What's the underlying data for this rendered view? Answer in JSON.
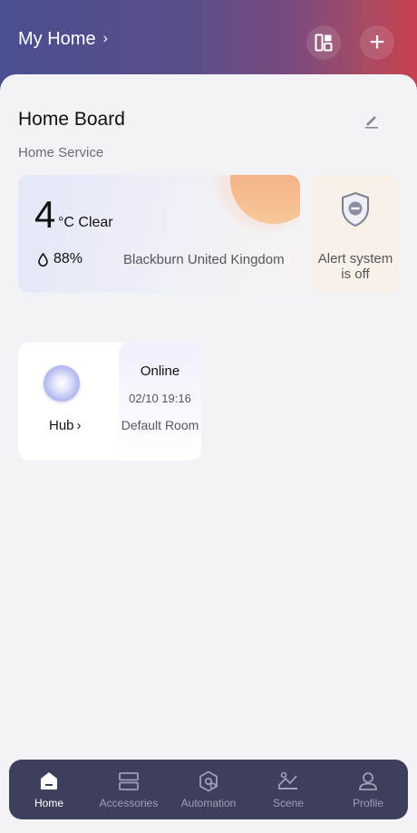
{
  "header": {
    "home_name": "My Home",
    "chevron": "›",
    "layout_icon": "dashboard-layout-icon",
    "add_icon": "plus-icon",
    "add_glyph": "+"
  },
  "board": {
    "title": "Home Board",
    "edit_icon": "pencil-icon",
    "service_label": "Home Service"
  },
  "weather": {
    "temperature": "4",
    "unit_condition": "°C Clear",
    "humidity": "88%",
    "location": "Blackburn United Kingdom",
    "humidity_icon": "droplet-icon"
  },
  "alert": {
    "text": "Alert system is off",
    "icon": "shield-icon"
  },
  "hub": {
    "name": "Hub",
    "chevron": "›",
    "status": "Online",
    "time": "02/10 19:16",
    "room": "Default Room"
  },
  "tabs": [
    {
      "label": "Home",
      "icon": "home-icon",
      "active": true
    },
    {
      "label": "Accessories",
      "icon": "accessories-icon",
      "active": false
    },
    {
      "label": "Automation",
      "icon": "automation-icon",
      "active": false
    },
    {
      "label": "Scene",
      "icon": "scene-icon",
      "active": false
    },
    {
      "label": "Profile",
      "icon": "profile-icon",
      "active": false
    }
  ],
  "colors": {
    "header_gradient_start": "#4a4f8f",
    "header_gradient_end": "#c9404f",
    "tabbar_bg": "#3e3f5c",
    "tab_inactive": "#9fa0b5",
    "tab_active": "#ffffff"
  }
}
